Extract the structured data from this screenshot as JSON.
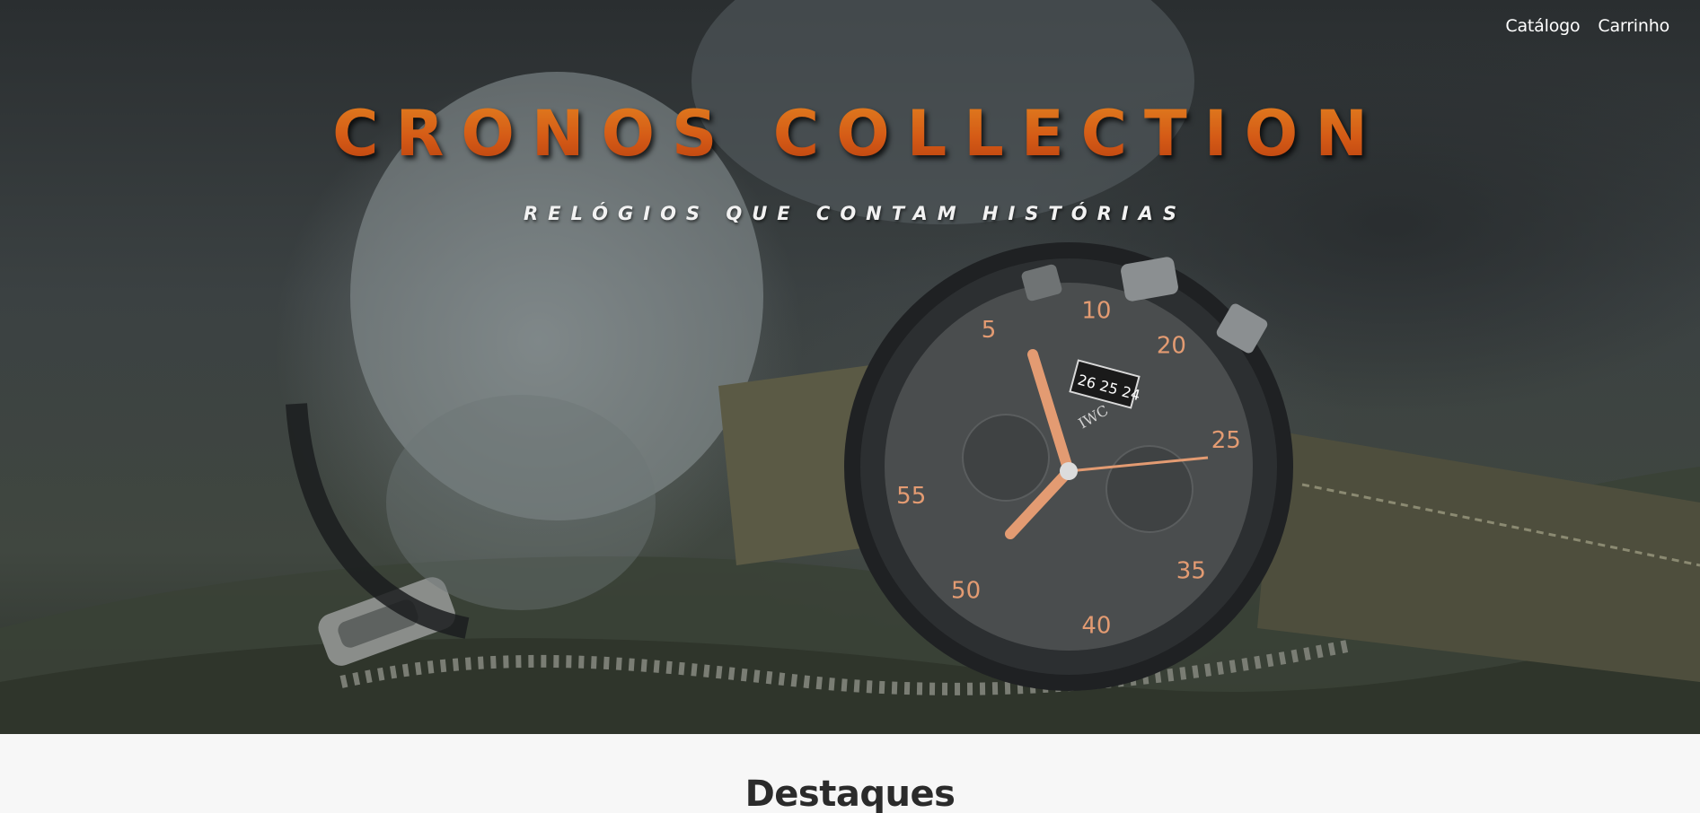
{
  "nav": {
    "links": [
      {
        "label": "Catálogo"
      },
      {
        "label": "Carrinho"
      }
    ]
  },
  "hero": {
    "title": "CRONOS COLLECTION",
    "tagline": "RELÓGIOS QUE CONTAM HISTÓRIAS",
    "image_subject": "pilot chronograph watch on olive flight gear"
  },
  "watch": {
    "brand": "IWC",
    "date_window": [
      "26",
      "25",
      "24"
    ],
    "dial_numerals": [
      "5",
      "10",
      "20",
      "25",
      "35",
      "40",
      "50",
      "55"
    ]
  },
  "featured": {
    "heading": "Destaques"
  },
  "colors": {
    "accent": "#d9661a",
    "page_background": "#f7f7f7",
    "heading_text": "#2b2b2b"
  }
}
